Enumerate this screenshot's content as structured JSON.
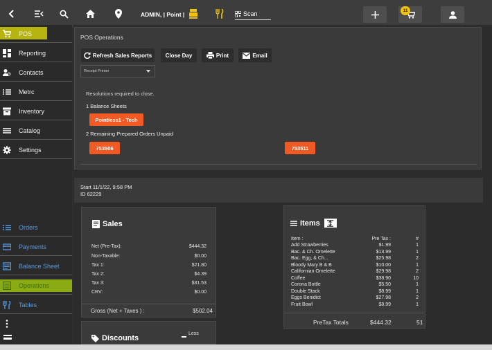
{
  "topbar": {
    "user_label": "ADMIN, | Point |",
    "scan_label": "Scan",
    "cart_count": "11"
  },
  "sidebar": {
    "items": [
      {
        "label": "POS"
      },
      {
        "label": "Reporting"
      },
      {
        "label": "Contacts"
      },
      {
        "label": "Metrc"
      },
      {
        "label": "Inventory"
      },
      {
        "label": "Catalog"
      },
      {
        "label": "Settings"
      }
    ],
    "bottom_items": [
      {
        "label": "Orders"
      },
      {
        "label": "Payments"
      },
      {
        "label": "Balance Sheet"
      },
      {
        "label": "Operations"
      },
      {
        "label": "Tables"
      }
    ]
  },
  "ops": {
    "title": "POS Operations",
    "refresh_label": "Refresh Sales Reports",
    "close_day_label": "Close Day",
    "print_label": "Print",
    "email_label": "Email",
    "printer_select": "Receipt Printer",
    "resolutions_text": "Resolutions required to close.",
    "balance_sheets_text": "1 Balance Sheets",
    "balance_sheet_btn": "Pointless1 - Tech",
    "unpaid_text": "2 Remaining Prepared Orders Unpaid",
    "orders": [
      "753506",
      "753511"
    ]
  },
  "session": {
    "start": "Start 11/1/22, 9:58 PM",
    "id": "ID 62229"
  },
  "sales": {
    "title": "Sales",
    "rows": [
      {
        "label": "Net (Pre-Tax):",
        "value": "$444.32"
      },
      {
        "label": "Non-Taxable:",
        "value": "$0.00"
      },
      {
        "label": "Tax 1:",
        "value": "$21.80"
      },
      {
        "label": "Tax 2:",
        "value": "$4.39"
      },
      {
        "label": "Tax 3:",
        "value": "$31.53"
      },
      {
        "label": "CRV:",
        "value": "$0.00"
      }
    ],
    "gross_label": "Gross (Net + Taxes ) :",
    "gross_value": "$502.04"
  },
  "discounts": {
    "title": "Discounts",
    "less_label": "Less"
  },
  "items": {
    "title": "Items",
    "col_item": "Item :",
    "col_pretax": "Pre Tax :",
    "col_qty": "#",
    "rows": [
      {
        "name": "Add Strawberries",
        "price": "$1.99",
        "qty": "1"
      },
      {
        "name": "Bac. & Ch. Omelette",
        "price": "$13.99",
        "qty": "1"
      },
      {
        "name": "Bac. Egg, & Ch...",
        "price": "$25.98",
        "qty": "2"
      },
      {
        "name": "Bloody Mary B & B",
        "price": "$10.00",
        "qty": "1"
      },
      {
        "name": "Californian Omelette",
        "price": "$29.98",
        "qty": "2"
      },
      {
        "name": "Coffee",
        "price": "$38.90",
        "qty": "10"
      },
      {
        "name": "Corona Bottle",
        "price": "$5.50",
        "qty": "1"
      },
      {
        "name": "Double Stack",
        "price": "$8.99",
        "qty": "1"
      },
      {
        "name": "Eggs Benidict",
        "price": "$27.98",
        "qty": "2"
      },
      {
        "name": "Fruit Bowl",
        "price": "$8.99",
        "qty": "1"
      }
    ],
    "totals_label": "PreTax Totals",
    "totals_value": "$444.32",
    "totals_qty": "51"
  },
  "colors": {
    "accent_orange": "#f25a23",
    "pos_yellow": "#f2c30f",
    "link_blue": "#5b9be0"
  }
}
